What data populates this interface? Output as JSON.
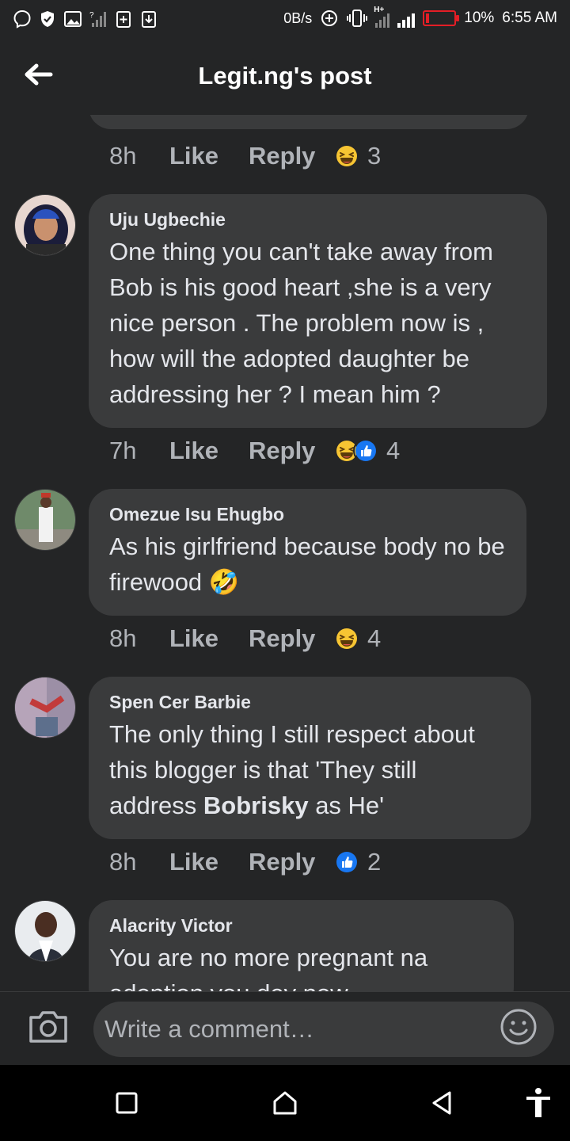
{
  "status_bar": {
    "net_speed": "0B/s",
    "signal_tag": "H+",
    "battery_percent": "10%",
    "battery_level": 0.1,
    "time": "6:55 AM",
    "left_icons": [
      "messenger-icon",
      "shield-check-icon",
      "image-icon",
      "no-signal-icon",
      "plus-box-icon",
      "download-box-icon"
    ]
  },
  "header": {
    "title": "Legit.ng's post"
  },
  "colors": {
    "bg": "#242526",
    "bubble": "#3a3b3c",
    "muted": "#b0b3b8",
    "text": "#e4e6eb",
    "like_blue": "#1877f2",
    "haha_yellow": "#f7c533"
  },
  "top_meta": {
    "time": "8h",
    "like": "Like",
    "reply": "Reply",
    "reactions": [
      "haha"
    ],
    "count": "3"
  },
  "comments": [
    {
      "author": "Uju Ugbechie",
      "text": "One thing you can't take away from Bob is his good heart ,she is a very nice person . The problem  now is , how will the adopted daughter be addressing her ? I mean him ?",
      "time": "7h",
      "like": "Like",
      "reply": "Reply",
      "reactions": [
        "haha",
        "like"
      ],
      "count": "4"
    },
    {
      "author": "Omezue Isu Ehugbo",
      "text": "As his girlfriend because body no be firewood 🤣",
      "time": "8h",
      "like": "Like",
      "reply": "Reply",
      "reactions": [
        "haha"
      ],
      "count": "4"
    },
    {
      "author": "Spen Cer Barbie",
      "text_before": "The only thing I still respect about this blogger is that 'They still address ",
      "text_bold": "Bobrisky",
      "text_after": " as He'",
      "time": "8h",
      "like": "Like",
      "reply": "Reply",
      "reactions": [
        "like"
      ],
      "count": "2"
    },
    {
      "author": "Alacrity Victor",
      "text": "You are no more pregnant na adoption you dey now"
    }
  ],
  "composer": {
    "placeholder": "Write a comment…"
  },
  "nav": {
    "icons": [
      "recents-square-icon",
      "home-icon",
      "back-triangle-icon",
      "accessibility-icon"
    ]
  }
}
